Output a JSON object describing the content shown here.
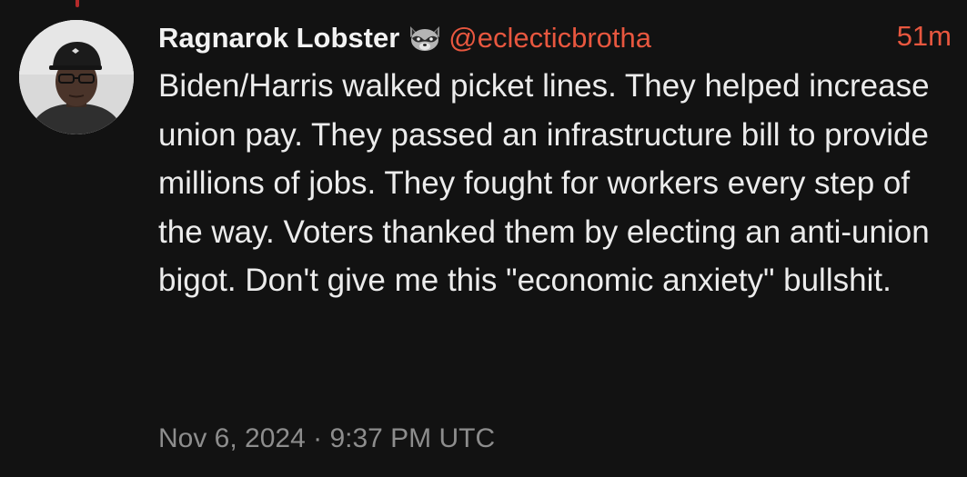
{
  "post": {
    "author": {
      "display_name": "Ragnarok Lobster",
      "badge_icon": "raccoon-face-icon",
      "handle": "@eclecticbrotha"
    },
    "relative_time": "51m",
    "text": "Biden/Harris walked picket lines. They helped increase union pay. They passed an infrastructure bill to provide millions of jobs. They fought for workers every step of the way. Voters thanked them by electing an anti-union bigot. Don't give me this \"economic anxiety\" bullshit.",
    "date": "Nov 6, 2024 · 9:37 PM UTC"
  },
  "colors": {
    "background": "#121212",
    "accent": "#e8573f",
    "text": "#ececec",
    "muted": "#8d8d8d",
    "thread_line": "#b32a2a"
  }
}
